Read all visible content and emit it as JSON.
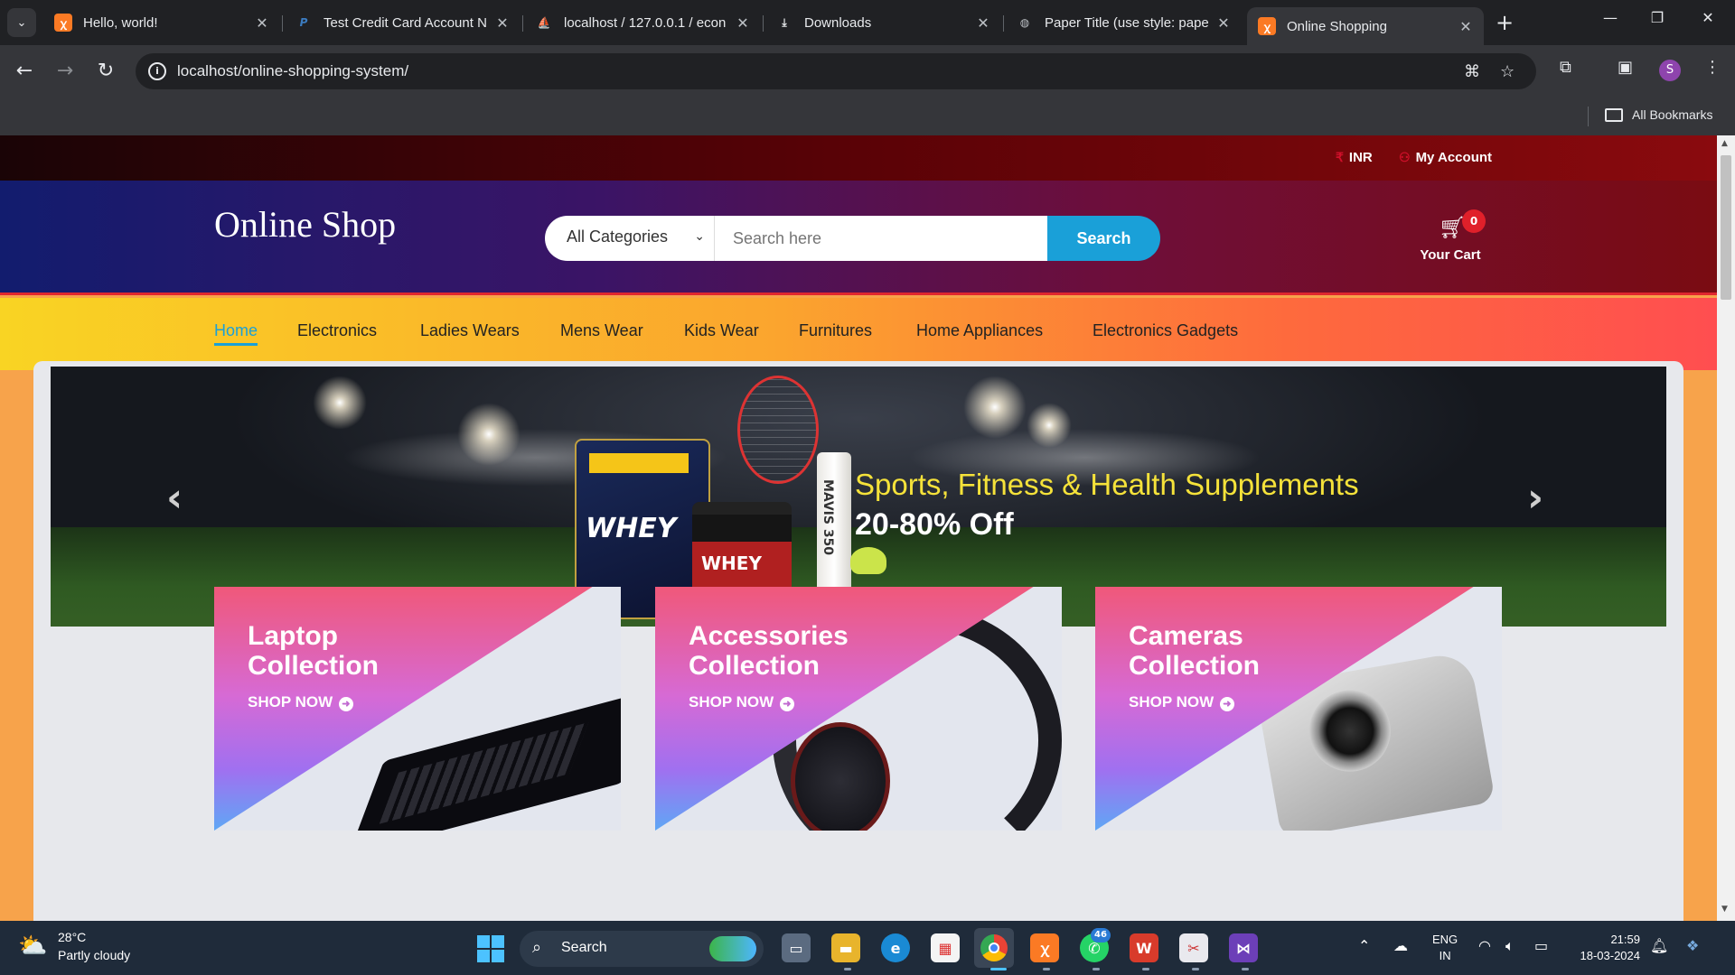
{
  "browser": {
    "tabs": [
      {
        "title": "Hello, world!",
        "favicon": "xampp-icon"
      },
      {
        "title": "Test Credit Card Account N",
        "favicon": "paypal-icon"
      },
      {
        "title": "localhost / 127.0.0.1 / econ",
        "favicon": "phpmyadmin-icon"
      },
      {
        "title": "Downloads",
        "favicon": "download-icon"
      },
      {
        "title": "Paper Title (use style: pape",
        "favicon": "globe-icon"
      },
      {
        "title": "Online Shopping",
        "favicon": "xampp-icon",
        "active": true
      }
    ],
    "url": "localhost/online-shopping-system/",
    "profile_initial": "S",
    "bookmarks_label": "All Bookmarks"
  },
  "site": {
    "topbar": {
      "currency": "INR",
      "account": "My Account"
    },
    "logo": "Online Shop",
    "search": {
      "category": "All Categories",
      "placeholder": "Search here",
      "button": "Search"
    },
    "cart": {
      "count": "0",
      "label": "Your Cart"
    },
    "nav": [
      "Home",
      "Electronics",
      "Ladies Wears",
      "Mens Wear",
      "Kids Wear",
      "Furnitures",
      "Home Appliances",
      "Electronics Gadgets"
    ],
    "active_nav": "Home",
    "hero": {
      "title": "Sports, Fitness & Health Supplements",
      "subtitle": "20-80% Off"
    },
    "hero_products": {
      "bag": "WHEY",
      "tub": "WHEY",
      "tube": "MAVIS 350"
    },
    "collections": [
      {
        "line1": "Laptop",
        "line2": "Collection",
        "cta": "SHOP NOW"
      },
      {
        "line1": "Accessories",
        "line2": "Collection",
        "cta": "SHOP NOW"
      },
      {
        "line1": "Cameras",
        "line2": "Collection",
        "cta": "SHOP NOW"
      }
    ]
  },
  "taskbar": {
    "weather": {
      "temp": "28°C",
      "condition": "Partly cloudy"
    },
    "search": "Search",
    "whatsapp_badge": "46",
    "lang": {
      "line1": "ENG",
      "line2": "IN"
    },
    "time": "21:59",
    "date": "18-03-2024"
  },
  "colors": {
    "accent": "#1aa0d8",
    "brand_red": "#e0202a",
    "nav_gradient_start": "#f9d423",
    "nav_gradient_end": "#ff4e50"
  }
}
